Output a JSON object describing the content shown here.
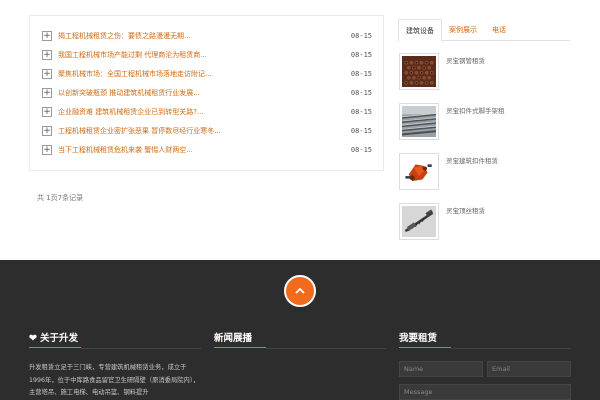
{
  "news": {
    "items": [
      {
        "title": "揭工程机械租赁之伤：要债之路漫漫无期...",
        "date": "08-15"
      },
      {
        "title": "我国工程机械市场产能过剩 代理商沦为租赁商...",
        "date": "08-15"
      },
      {
        "title": "聚焦机械市场：全国工程机械市场落地走访附记...",
        "date": "08-15"
      },
      {
        "title": "以创新突破瓶颈 推动建筑机械租赁行业发展...",
        "date": "08-15"
      },
      {
        "title": "企业融资难 建筑机械租赁企业已到转型关路?...",
        "date": "08-15"
      },
      {
        "title": "工程机械租赁企业密扩张恶果 暂停数尽经行业寒冬...",
        "date": "08-15"
      },
      {
        "title": "当下工程机械租赁危机来袭 警惕人财两空...",
        "date": "08-15"
      }
    ],
    "pager": "共 1页7条记录"
  },
  "sidebar": {
    "tabs": [
      "建筑设备",
      "案例展示",
      "电话"
    ],
    "products": [
      {
        "name": "灵宝钢管租赁",
        "icon": "steel-pipes-photo"
      },
      {
        "name": "灵宝扣件式脚手架租",
        "icon": "scaffold-pipes-photo"
      },
      {
        "name": "灵宝建筑扣件租赁",
        "icon": "scaffold-coupler-photo"
      },
      {
        "name": "灵宝顶丝租赁",
        "icon": "jack-screw-photo"
      }
    ]
  },
  "footer": {
    "about_title": "关于升发",
    "news_title": "新闻展播",
    "rent_title": "我要租赁",
    "about_text": "升发租赁立足于三门峡，专营建筑机械租赁业务，成立于1996年，位于中库路食品留官卫生研隔壁（原消委局院内），主营塔吊、施工电梯、电动吊篮、钢料提升",
    "name_placeholder": "Name",
    "email_placeholder": "Email",
    "message_placeholder": "Message"
  },
  "colors": {
    "accent": "#f26a1c",
    "link": "#d06a12",
    "footer_bg": "#2d2d2d"
  }
}
